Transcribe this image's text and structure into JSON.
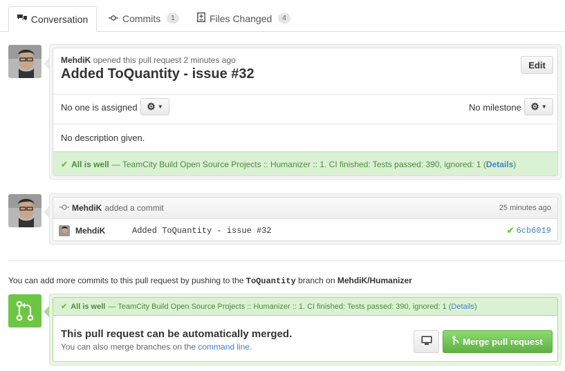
{
  "tabs": [
    {
      "label": "Conversation",
      "icon": "speech-bubbles-icon"
    },
    {
      "label": "Commits",
      "count": "1",
      "icon": "commit-icon"
    },
    {
      "label": "Files Changed",
      "count": "4",
      "icon": "file-diff-icon"
    }
  ],
  "pr": {
    "author": "MehdiK",
    "opened_text": "opened this pull request 2 minutes ago",
    "title": "Added ToQuantity - issue #32",
    "edit_label": "Edit",
    "assignee_text": "No one is assigned",
    "milestone_text": "No milestone",
    "description": "No description given."
  },
  "ci": {
    "status": "All is well",
    "text": "— TeamCity Build Open Source Projects :: Humanizer :: 1. CI finished: Tests passed: 390, ignored: 1 (",
    "details": "Details",
    "close": ")"
  },
  "commit_event": {
    "author": "MehdiK",
    "action": "added a commit",
    "time": "25 minutes ago",
    "commit_author": "MehdiK",
    "message": "Added ToQuantity - issue #32",
    "sha": "6cb6019"
  },
  "push_note": {
    "prefix": "You can add more commits to this pull request by pushing to the ",
    "branch": "ToQuantity",
    "middle": " branch on ",
    "repo": "MehdiK/Humanizer"
  },
  "merge": {
    "title": "This pull request can be automatically merged.",
    "subtitle": "You can also merge branches on the ",
    "link": "command line",
    "period": ".",
    "button": "Merge pull request"
  },
  "colors": {
    "success": "#6cc644",
    "link": "#4183c4"
  }
}
